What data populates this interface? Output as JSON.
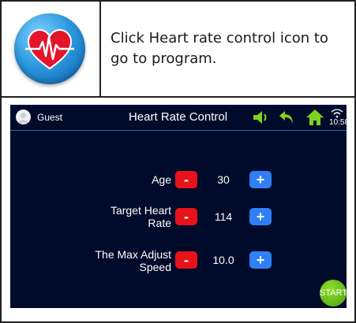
{
  "instruction": {
    "text": "Click Heart rate control icon to go to program."
  },
  "screen": {
    "user": "Guest",
    "title": "Heart Rate Control",
    "time": "10:58",
    "params": [
      {
        "label": "Age",
        "value": "30"
      },
      {
        "label": "Target Heart Rate",
        "value": "114"
      },
      {
        "label": "The Max Adjust Speed",
        "value": "10.0"
      }
    ],
    "minus_label": "-",
    "plus_label": "+",
    "start_label": "START"
  },
  "colors": {
    "screen_bg": "#000a2a",
    "toolbar_icons": "#7ed321",
    "minus_button": "#e8121a",
    "plus_button": "#2f7ff5",
    "start_button": "#5cb81a"
  },
  "icons": [
    "heart-rate-icon",
    "avatar-icon",
    "speaker-icon",
    "back-arrow-icon",
    "home-icon",
    "wifi-icon"
  ]
}
